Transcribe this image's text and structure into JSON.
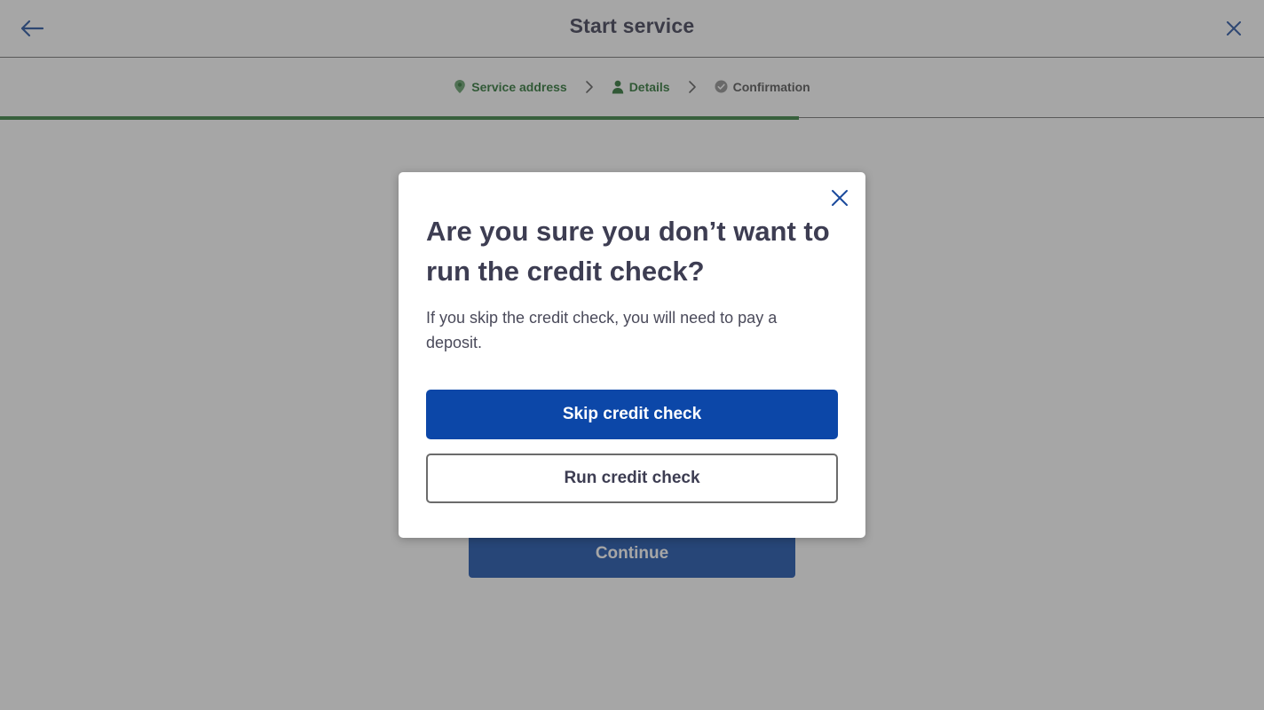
{
  "header": {
    "title": "Start service",
    "back_icon": "arrow-left-icon",
    "close_icon": "close-icon"
  },
  "stepper": {
    "steps": [
      {
        "label": "Service address",
        "icon": "map-pin-icon",
        "state": "done"
      },
      {
        "label": "Details",
        "icon": "person-icon",
        "state": "done"
      },
      {
        "label": "Confirmation",
        "icon": "check-circle-icon",
        "state": "pending"
      }
    ],
    "progress_fraction": 0.632
  },
  "background": {
    "continue_label": "Continue"
  },
  "modal": {
    "heading": "Are you sure you don’t want to run the credit check?",
    "body": "If you skip the credit check, you will need to pay a deposit.",
    "primary_label": "Skip credit check",
    "secondary_label": "Run credit check",
    "close_icon": "close-icon"
  },
  "colors": {
    "brand_blue": "#0c47a8",
    "step_done_green": "#1f6b2a",
    "progress_green": "#2b7a34",
    "heading_text": "#3d3d52"
  }
}
